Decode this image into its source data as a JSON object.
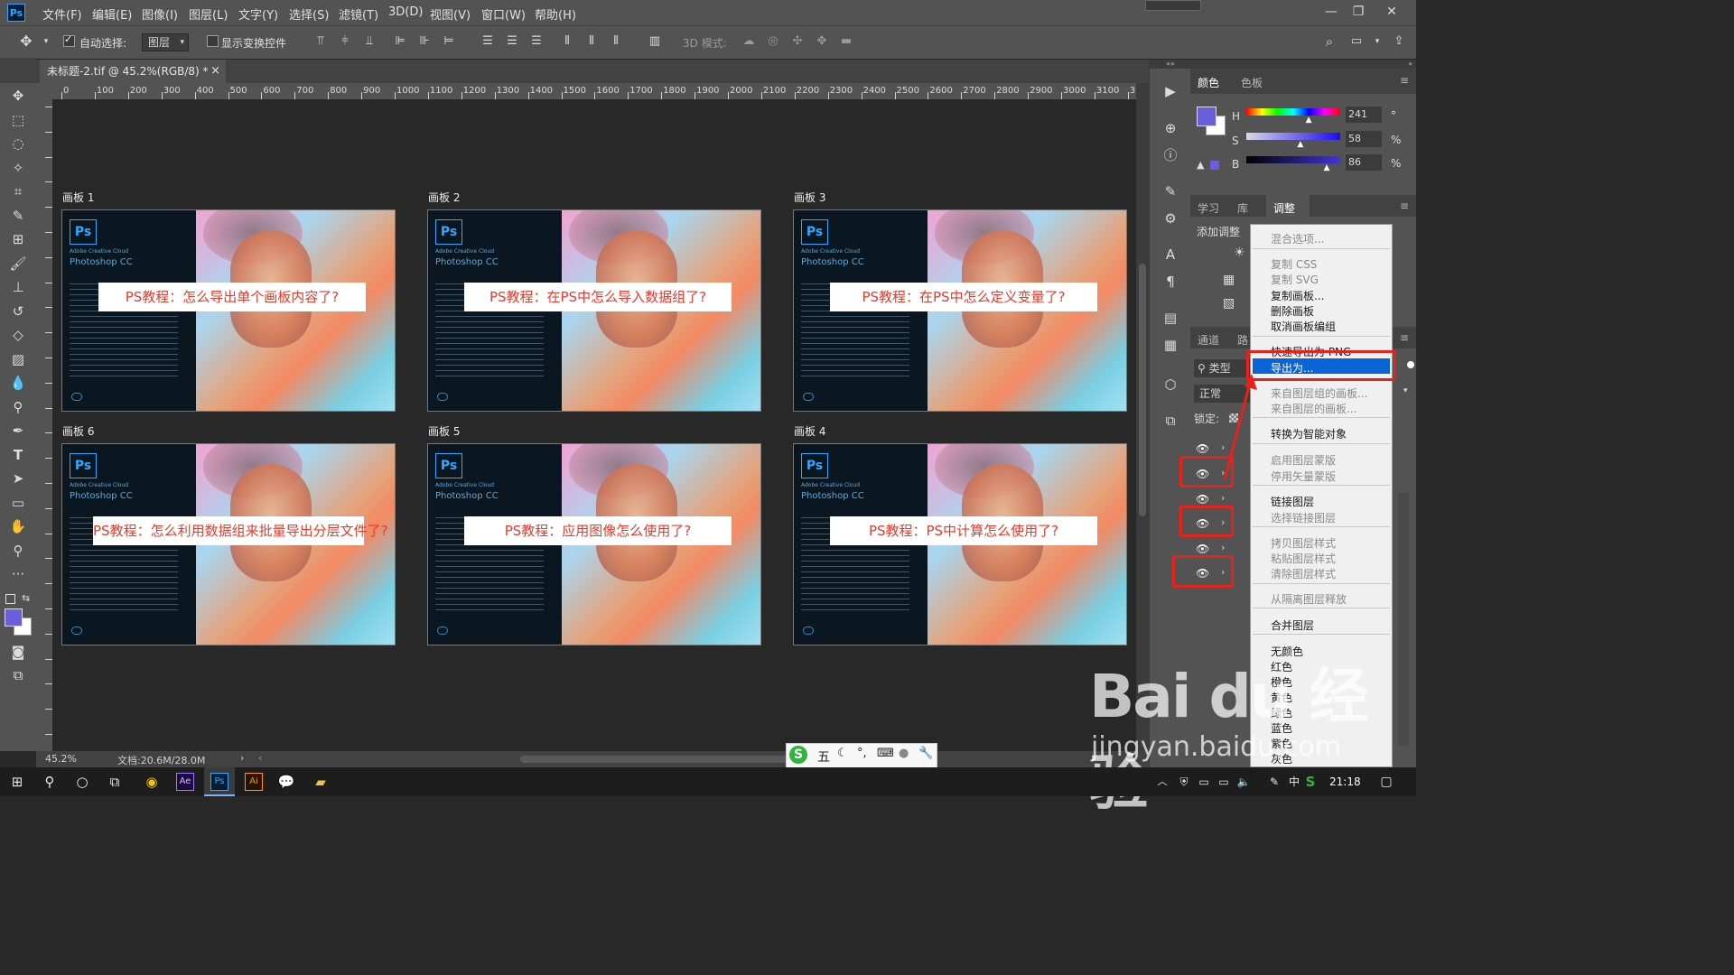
{
  "app": {
    "logo": "Ps"
  },
  "menu": [
    "文件(F)",
    "编辑(E)",
    "图像(I)",
    "图层(L)",
    "文字(Y)",
    "选择(S)",
    "滤镜(T)",
    "3D(D)",
    "视图(V)",
    "窗口(W)",
    "帮助(H)"
  ],
  "options": {
    "auto_select": "自动选择:",
    "layer_select": "图层",
    "show_transform": "显示变换控件",
    "mode_3d": "3D 模式:"
  },
  "document_tab": {
    "title": "未标题-2.tif @ 45.2%(RGB/8) *",
    "close": "×"
  },
  "ruler_h": [
    "0",
    "100",
    "200",
    "300",
    "400",
    "500",
    "600",
    "700",
    "800",
    "900",
    "1000",
    "1100",
    "1200",
    "1300",
    "1400",
    "1500",
    "1600",
    "1700",
    "1800",
    "1900",
    "2000",
    "2100",
    "2200",
    "2300",
    "2400",
    "2500",
    "2600",
    "2700",
    "2800",
    "2900",
    "3000",
    "3100",
    "3"
  ],
  "artboards": [
    {
      "label": "画板 1",
      "caption": "PS教程：怎么导出单个画板内容了?",
      "product_sub": "Adobe Creative Cloud",
      "product": "Photoshop CC"
    },
    {
      "label": "画板 2",
      "caption": "PS教程：在PS中怎么导入数据组了?",
      "product_sub": "Adobe Creative Cloud",
      "product": "Photoshop CC"
    },
    {
      "label": "画板 3",
      "caption": "PS教程：在PS中怎么定义变量了?",
      "product_sub": "Adobe Creative Cloud",
      "product": "Photoshop CC"
    },
    {
      "label": "画板 6",
      "caption": "PS教程：怎么利用数据组来批量导出分层文件了?",
      "product_sub": "Adobe Creative Cloud",
      "product": "Photoshop CC"
    },
    {
      "label": "画板 5",
      "caption": "PS教程：应用图像怎么使用了?",
      "product_sub": "Adobe Creative Cloud",
      "product": "Photoshop CC"
    },
    {
      "label": "画板 4",
      "caption": "PS教程：PS中计算怎么使用了?",
      "product_sub": "Adobe Creative Cloud",
      "product": "Photoshop CC"
    }
  ],
  "status": {
    "zoom": "45.2%",
    "doc": "文档:20.6M/28.0M"
  },
  "color_panel": {
    "tabs": [
      "颜色",
      "色板"
    ],
    "h_label": "H",
    "s_label": "S",
    "b_label": "B",
    "h": "241",
    "s": "58",
    "b": "86",
    "h_unit": "°",
    "s_unit": "%",
    "b_unit": "%",
    "h_value": 241,
    "s_value": 58,
    "b_value": 86,
    "fg_color": "#6a5fdb"
  },
  "adjust_panel": {
    "tabs": [
      "学习",
      "库",
      "调整"
    ],
    "add_label": "添加调整"
  },
  "layers_panel": {
    "tabs": [
      "通道",
      "路"
    ],
    "kind": "类型",
    "blend": "正常",
    "lock": "锁定:"
  },
  "context_menu": {
    "items": [
      {
        "label": "混合选项...",
        "disabled": true
      },
      {
        "label": "复制 CSS",
        "disabled": true
      },
      {
        "label": "复制 SVG",
        "disabled": true
      },
      {
        "label": "复制画板...",
        "disabled": false
      },
      {
        "label": "删除画板",
        "disabled": false
      },
      {
        "label": "取消画板编组",
        "disabled": false
      },
      {
        "label": "快速导出为 PNG",
        "disabled": false
      },
      {
        "label": "导出为...",
        "disabled": false,
        "highlighted": true
      },
      {
        "label": "来自图层组的画板...",
        "disabled": true
      },
      {
        "label": "来自图层的画板...",
        "disabled": true
      },
      {
        "label": "转换为智能对象",
        "disabled": false
      },
      {
        "label": "启用图层蒙版",
        "disabled": true
      },
      {
        "label": "停用矢量蒙版",
        "disabled": true
      },
      {
        "label": "链接图层",
        "disabled": false
      },
      {
        "label": "选择链接图层",
        "disabled": true
      },
      {
        "label": "拷贝图层样式",
        "disabled": true
      },
      {
        "label": "粘贴图层样式",
        "disabled": true
      },
      {
        "label": "清除图层样式",
        "disabled": true
      },
      {
        "label": "从隔离图层释放",
        "disabled": true
      },
      {
        "label": "合并图层",
        "disabled": false
      },
      {
        "label": "无颜色",
        "disabled": false
      },
      {
        "label": "红色",
        "disabled": false
      },
      {
        "label": "橙色",
        "disabled": false
      },
      {
        "label": "黄色",
        "disabled": false
      },
      {
        "label": "绿色",
        "disabled": false
      },
      {
        "label": "蓝色",
        "disabled": false
      },
      {
        "label": "紫色",
        "disabled": false
      },
      {
        "label": "灰色",
        "disabled": false
      }
    ]
  },
  "taskbar": {
    "time": "21:18",
    "ime_mode": "五"
  },
  "watermark": {
    "brand": "Bai du 经验",
    "url": "jingyan.baidu.com"
  }
}
